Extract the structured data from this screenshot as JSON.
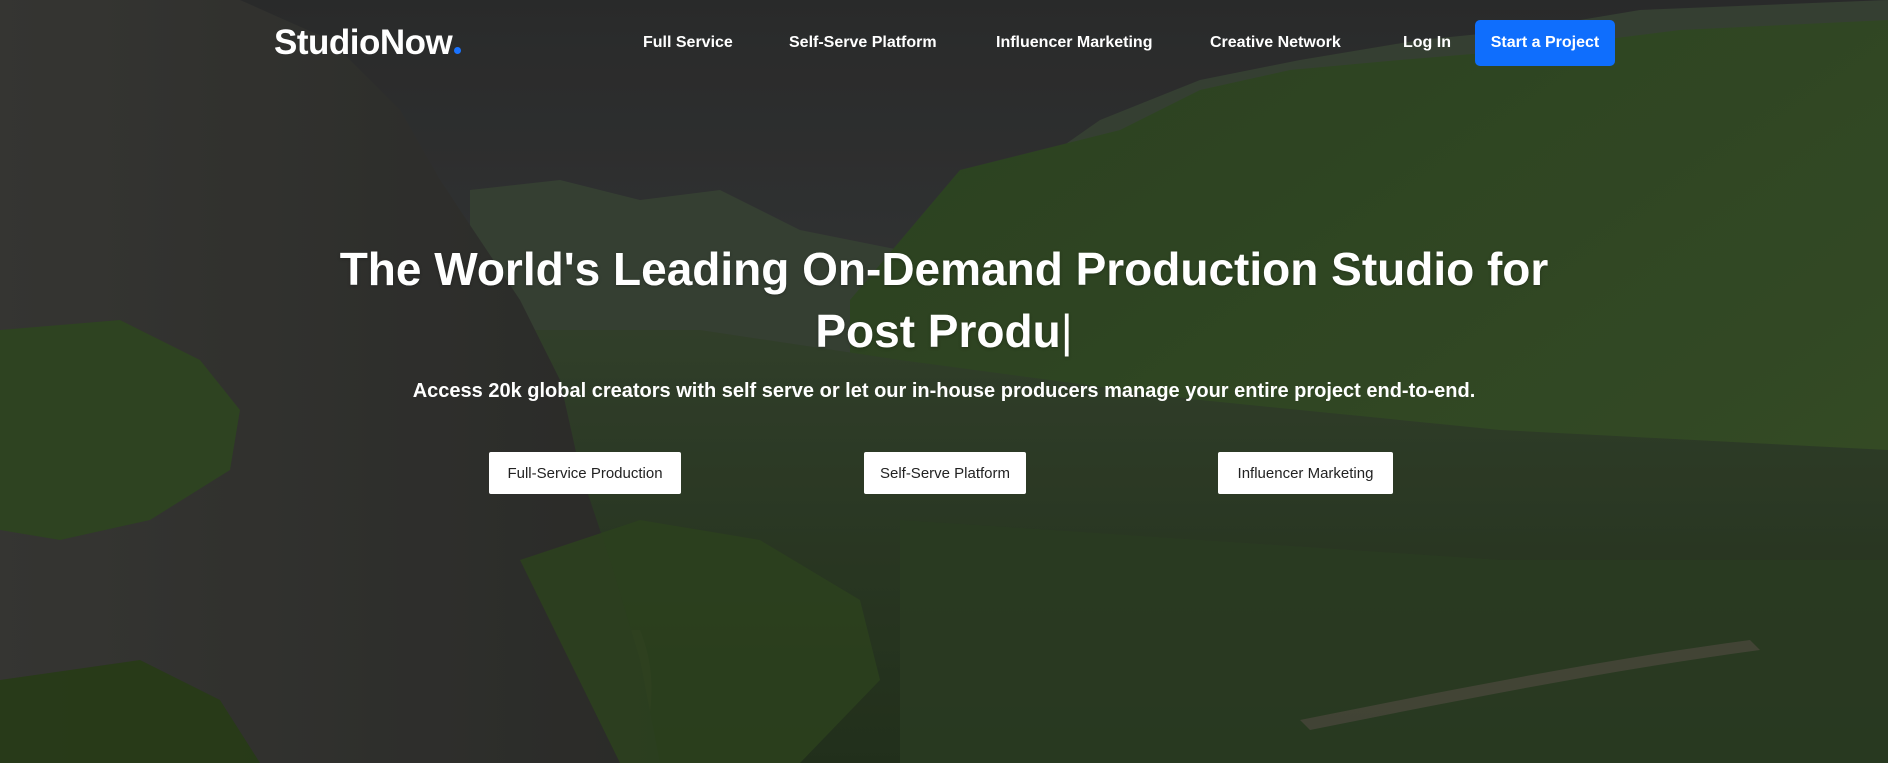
{
  "brand": {
    "logo_prefix": "StudioN",
    "logo_o": "o",
    "logo_suffix": "w",
    "accent_color": "#0f6efd"
  },
  "nav": {
    "items": [
      {
        "label": "Full Service"
      },
      {
        "label": "Self-Serve Platform"
      },
      {
        "label": "Influencer Marketing"
      },
      {
        "label": "Creative Network"
      },
      {
        "label": "Log In"
      }
    ],
    "cta_label": "Start a Project"
  },
  "hero": {
    "headline_line1": "The World's Leading On-Demand Production Studio for",
    "headline_line2": "Post Produ",
    "cursor": "|",
    "subheadline": "Access 20k global creators with self serve or let our in-house producers manage your entire project end-to-end.",
    "buttons": [
      {
        "label": "Full-Service Production"
      },
      {
        "label": "Self-Serve Platform"
      },
      {
        "label": "Influencer Marketing"
      }
    ]
  }
}
